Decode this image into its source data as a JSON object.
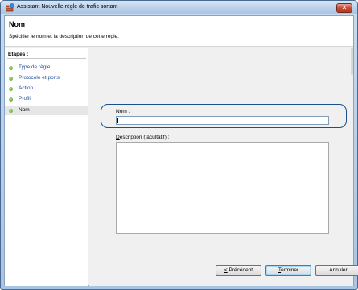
{
  "window": {
    "title": "Assistant Nouvelle règle de trafic sortant",
    "close_label": "✕"
  },
  "header": {
    "title": "Nom",
    "subtitle": "Spécifier le nom et la description de cette règle."
  },
  "steps": {
    "title": "Étapes :",
    "items": [
      {
        "label": "Type de règle",
        "state": "link"
      },
      {
        "label": "Protocole et ports",
        "state": "link"
      },
      {
        "label": "Action",
        "state": "link"
      },
      {
        "label": "Profil",
        "state": "link"
      },
      {
        "label": "Nom",
        "state": "active"
      }
    ]
  },
  "form": {
    "name_label_accel": "N",
    "name_label_rest": "om :",
    "name_value": "",
    "desc_label_accel": "D",
    "desc_label_rest": "escription (facultatif) :",
    "desc_value": ""
  },
  "buttons": {
    "previous_accel": "<",
    "previous_rest": " Précédent",
    "finish_accel": "T",
    "finish_rest": "erminer",
    "cancel": "Annuler"
  },
  "colors": {
    "step_dot": "#4d9a1e",
    "link": "#1f4e9a",
    "focus_ring": "#1a4f8c"
  }
}
